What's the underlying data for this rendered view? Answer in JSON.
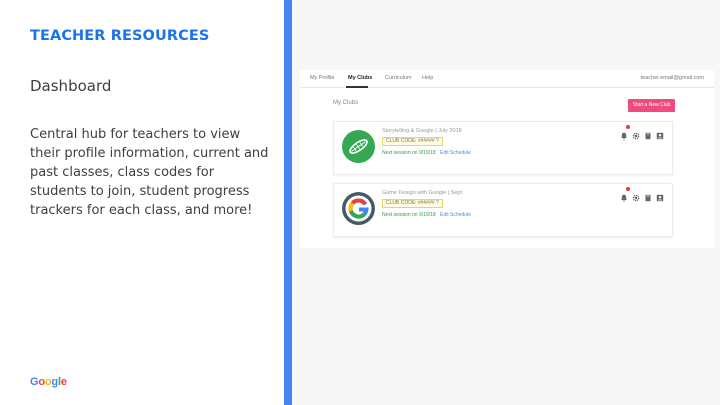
{
  "left": {
    "kicker": "TEACHER RESOURCES",
    "subhead": "Dashboard",
    "description": "Central hub for teachers to view their profile information, current and past classes, class codes for students to join, student progress trackers for each class, and more!",
    "brand": {
      "g1": "G",
      "o1": "o",
      "o2": "o",
      "g2": "g",
      "l": "l",
      "e": "e"
    }
  },
  "screenshot": {
    "nav": {
      "items": [
        {
          "label": "My Profile"
        },
        {
          "label": "My Clubs"
        },
        {
          "label": "Curriculum"
        },
        {
          "label": "Help"
        }
      ],
      "email": "teacher.email@gmail.com"
    },
    "page_title": "My Clubs",
    "start_button": "Start a New Club",
    "clubs": [
      {
        "name": "Storytelling & Google | July 2018",
        "code": "CLUB CODE: ###### ?",
        "session": "Next session on 9/19/18",
        "edit": "Edit Schedule",
        "logo_color": "#34a853",
        "logo_icon": "leaf-pen-icon"
      },
      {
        "name": "Game Design with Google | Sept",
        "code": "CLUB CODE: ###### ?",
        "session": "Next session on 9/19/18",
        "edit": "Edit Schedule",
        "logo_color": "#455a64",
        "logo_icon": "google-g-icon"
      }
    ],
    "colors": {
      "accent": "#4285f4",
      "button": "#ef4b7c",
      "session": "#2e9f45",
      "badge": "#e53935"
    }
  }
}
